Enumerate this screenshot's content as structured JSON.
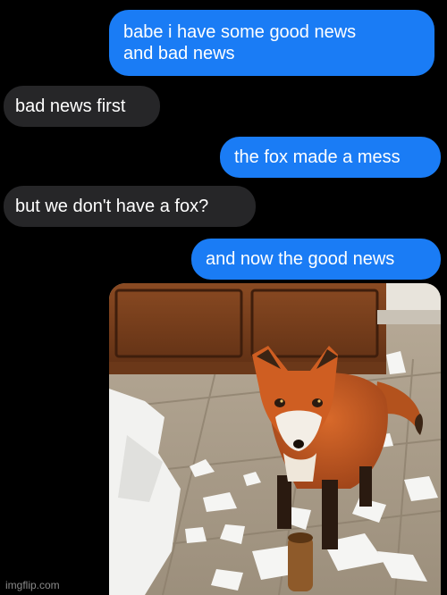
{
  "conversation": {
    "messages": [
      {
        "sender": "me",
        "text_line1": "babe i have some good news",
        "text_line2": "and bad news"
      },
      {
        "sender": "them",
        "text": "bad news first"
      },
      {
        "sender": "me",
        "text": "the fox made a mess"
      },
      {
        "sender": "them",
        "text": "but we don't have a fox?"
      },
      {
        "sender": "me",
        "text": "and now the good news"
      }
    ],
    "attachment": {
      "type": "photo",
      "subject": "fox-with-shredded-paper"
    }
  },
  "watermark": "imgflip.com",
  "colors": {
    "background": "#000000",
    "sent_bubble": "#1a7cf5",
    "received_bubble": "#262628",
    "text": "#ffffff"
  }
}
